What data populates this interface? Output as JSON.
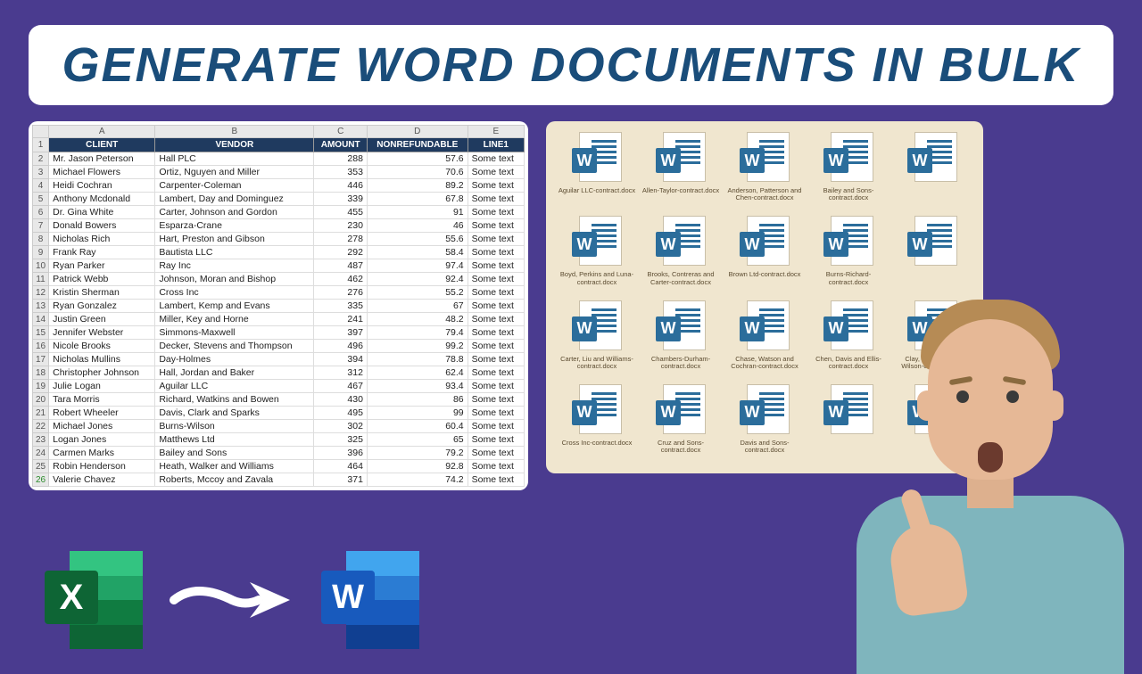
{
  "title": "GENERATE WORD DOCUMENTS IN BULK",
  "spreadsheet": {
    "columns": [
      "A",
      "B",
      "C",
      "D",
      "E"
    ],
    "headers": [
      "CLIENT",
      "VENDOR",
      "AMOUNT",
      "NONREFUNDABLE",
      "LINE1"
    ],
    "rows": [
      {
        "n": 2,
        "client": "Mr. Jason Peterson",
        "vendor": "Hall PLC",
        "amount": 288,
        "nonref": 57.6,
        "line1": "Some text"
      },
      {
        "n": 3,
        "client": "Michael Flowers",
        "vendor": "Ortiz, Nguyen and Miller",
        "amount": 353,
        "nonref": 70.6,
        "line1": "Some text"
      },
      {
        "n": 4,
        "client": "Heidi Cochran",
        "vendor": "Carpenter-Coleman",
        "amount": 446,
        "nonref": 89.2,
        "line1": "Some text"
      },
      {
        "n": 5,
        "client": "Anthony Mcdonald",
        "vendor": "Lambert, Day and Dominguez",
        "amount": 339,
        "nonref": 67.8,
        "line1": "Some text"
      },
      {
        "n": 6,
        "client": "Dr. Gina White",
        "vendor": "Carter, Johnson and Gordon",
        "amount": 455,
        "nonref": 91,
        "line1": "Some text"
      },
      {
        "n": 7,
        "client": "Donald Bowers",
        "vendor": "Esparza-Crane",
        "amount": 230,
        "nonref": 46,
        "line1": "Some text"
      },
      {
        "n": 8,
        "client": "Nicholas Rich",
        "vendor": "Hart, Preston and Gibson",
        "amount": 278,
        "nonref": 55.6,
        "line1": "Some text"
      },
      {
        "n": 9,
        "client": "Frank Ray",
        "vendor": "Bautista LLC",
        "amount": 292,
        "nonref": 58.4,
        "line1": "Some text"
      },
      {
        "n": 10,
        "client": "Ryan Parker",
        "vendor": "Ray Inc",
        "amount": 487,
        "nonref": 97.4,
        "line1": "Some text"
      },
      {
        "n": 11,
        "client": "Patrick Webb",
        "vendor": "Johnson, Moran and Bishop",
        "amount": 462,
        "nonref": 92.4,
        "line1": "Some text"
      },
      {
        "n": 12,
        "client": "Kristin Sherman",
        "vendor": "Cross Inc",
        "amount": 276,
        "nonref": 55.2,
        "line1": "Some text"
      },
      {
        "n": 13,
        "client": "Ryan Gonzalez",
        "vendor": "Lambert, Kemp and Evans",
        "amount": 335,
        "nonref": 67,
        "line1": "Some text"
      },
      {
        "n": 14,
        "client": "Justin Green",
        "vendor": "Miller, Key and Horne",
        "amount": 241,
        "nonref": 48.2,
        "line1": "Some text"
      },
      {
        "n": 15,
        "client": "Jennifer Webster",
        "vendor": "Simmons-Maxwell",
        "amount": 397,
        "nonref": 79.4,
        "line1": "Some text"
      },
      {
        "n": 16,
        "client": "Nicole Brooks",
        "vendor": "Decker, Stevens and Thompson",
        "amount": 496,
        "nonref": 99.2,
        "line1": "Some text"
      },
      {
        "n": 17,
        "client": "Nicholas Mullins",
        "vendor": "Day-Holmes",
        "amount": 394,
        "nonref": 78.8,
        "line1": "Some text"
      },
      {
        "n": 18,
        "client": "Christopher Johnson",
        "vendor": "Hall, Jordan and Baker",
        "amount": 312,
        "nonref": 62.4,
        "line1": "Some text"
      },
      {
        "n": 19,
        "client": "Julie Logan",
        "vendor": "Aguilar LLC",
        "amount": 467,
        "nonref": 93.4,
        "line1": "Some text"
      },
      {
        "n": 20,
        "client": "Tara Morris",
        "vendor": "Richard, Watkins and Bowen",
        "amount": 430,
        "nonref": 86,
        "line1": "Some text"
      },
      {
        "n": 21,
        "client": "Robert Wheeler",
        "vendor": "Davis, Clark and Sparks",
        "amount": 495,
        "nonref": 99,
        "line1": "Some text"
      },
      {
        "n": 22,
        "client": "Michael Jones",
        "vendor": "Burns-Wilson",
        "amount": 302,
        "nonref": 60.4,
        "line1": "Some text"
      },
      {
        "n": 23,
        "client": "Logan Jones",
        "vendor": "Matthews Ltd",
        "amount": 325,
        "nonref": 65,
        "line1": "Some text"
      },
      {
        "n": 24,
        "client": "Carmen Marks",
        "vendor": "Bailey and Sons",
        "amount": 396,
        "nonref": 79.2,
        "line1": "Some text"
      },
      {
        "n": 25,
        "client": "Robin Henderson",
        "vendor": "Heath, Walker and Williams",
        "amount": 464,
        "nonref": 92.8,
        "line1": "Some text"
      },
      {
        "n": 26,
        "client": "Valerie Chavez",
        "vendor": "Roberts, Mccoy and Zavala",
        "amount": 371,
        "nonref": 74.2,
        "line1": "Some text"
      }
    ]
  },
  "folder": {
    "files": [
      "Aguilar LLC-contract.docx",
      "Allen-Taylor-contract.docx",
      "Anderson, Patterson and Chen-contract.docx",
      "Bailey and Sons-contract.docx",
      " ",
      "Boyd, Perkins and Luna-contract.docx",
      "Brooks, Contreras and Carter-contract.docx",
      "Brown Ltd-contract.docx",
      "Burns-Richard-contract.docx",
      " ",
      "Carter, Liu and Williams-contract.docx",
      "Chambers-Durham-contract.docx",
      "Chase, Watson and Cochran-contract.docx",
      "Chen, Davis and Ellis-contract.docx",
      "Clay, Sanders and Wilson-contract.docx",
      "Cross Inc-contract.docx",
      "Cruz and Sons-contract.docx",
      "Davis and Sons-contract.docx",
      " ",
      " "
    ]
  },
  "icons": {
    "excel_letter": "X",
    "word_letter": "W",
    "file_letter": "W"
  }
}
